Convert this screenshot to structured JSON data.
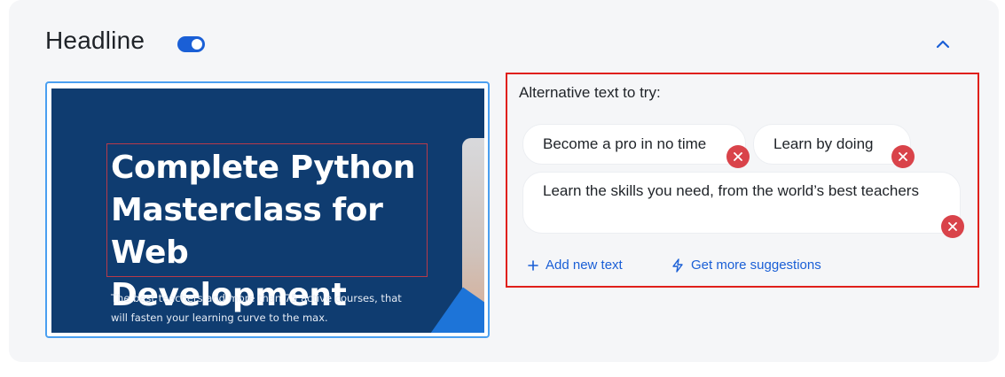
{
  "section": {
    "title": "Headline",
    "toggle_on": true,
    "accent_color": "#1a5fd6"
  },
  "preview": {
    "heading": "Complete Python Masterclass for Web Development",
    "subtext": "The best teachers and more than 75 active courses, that will fasten your learning curve to the max.",
    "background_color": "#0f3c70"
  },
  "alternatives": {
    "label": "Alternative text to try:",
    "items": [
      {
        "text": "Become a pro in no time"
      },
      {
        "text": "Learn by doing"
      },
      {
        "text": "Learn the skills you need, from the world’s best teachers"
      }
    ],
    "add_label": "Add new text",
    "suggest_label": "Get more suggestions",
    "remove_color": "#d9434a",
    "highlight_color": "#e0201a"
  },
  "icons": {
    "collapse": "chevron-up-icon",
    "remove": "close-icon",
    "add": "plus-icon",
    "suggest": "lightning-icon"
  }
}
